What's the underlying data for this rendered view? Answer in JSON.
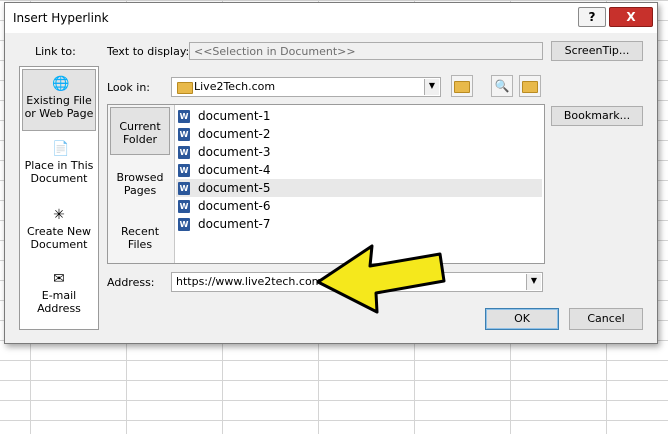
{
  "dialog": {
    "title": "Insert Hyperlink",
    "help_button": "?",
    "close_button": "X"
  },
  "link_to": {
    "label": "Link to:",
    "items": [
      {
        "line1": "Existing File",
        "line2": "or Web Page",
        "icon": "web-page-globe-icon"
      },
      {
        "line1": "Place in This",
        "line2": "Document",
        "icon": "document-place-icon"
      },
      {
        "line1": "Create New",
        "line2": "Document",
        "icon": "new-document-icon"
      },
      {
        "line1": "E-mail",
        "line2": "Address",
        "icon": "email-icon"
      }
    ]
  },
  "text_to_display": {
    "label": "Text to display:",
    "value": "<<Selection in Document>>"
  },
  "screentip_button": "ScreenTip...",
  "look_in": {
    "label": "Look in:",
    "value": "Live2Tech.com",
    "icons": [
      "up-folder-icon",
      "browse-web-icon",
      "browse-file-icon"
    ]
  },
  "bookmark_button": "Bookmark...",
  "file_nav": [
    {
      "line1": "Current",
      "line2": "Folder"
    },
    {
      "line1": "Browsed",
      "line2": "Pages"
    },
    {
      "line1": "Recent",
      "line2": "Files"
    }
  ],
  "files": [
    "document-1",
    "document-2",
    "document-3",
    "document-4",
    "document-5",
    "document-6",
    "document-7"
  ],
  "address": {
    "label": "Address:",
    "value": "https://www.live2tech.com"
  },
  "ok_button": "OK",
  "cancel_button": "Cancel",
  "annotation": {
    "arrow_color": "#f5e81c",
    "arrow_outline": "#000000"
  }
}
